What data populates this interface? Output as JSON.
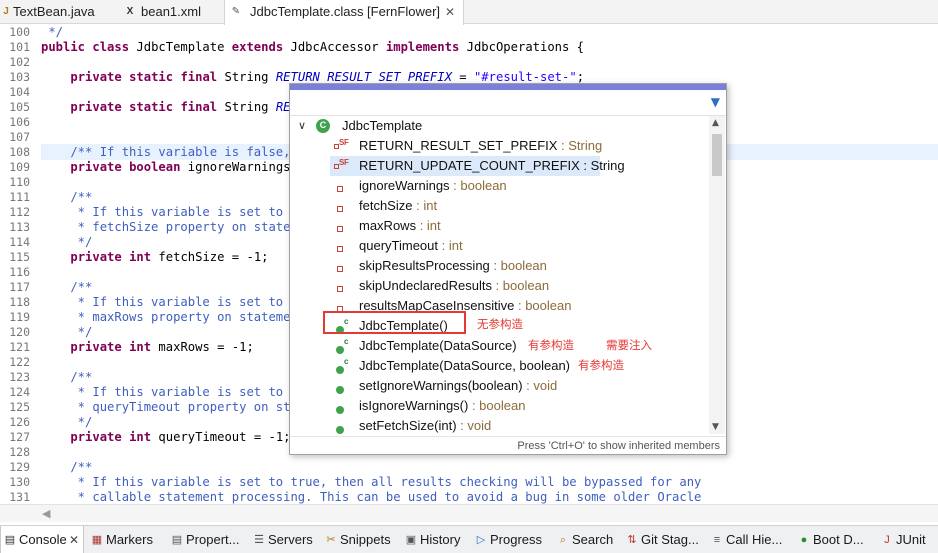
{
  "editor_tabs": [
    {
      "label": "TextBean.java"
    },
    {
      "label": "bean1.xml"
    },
    {
      "label": "JdbcTemplate.class [FernFlower]"
    }
  ],
  "code_lines": [
    {
      "n": "100",
      "text": " */"
    },
    {
      "n": "101",
      "text": "public class JdbcTemplate extends JdbcAccessor implements JdbcOperations {"
    },
    {
      "n": "102",
      "text": ""
    },
    {
      "n": "103",
      "text": "    private static final String RETURN_RESULT_SET_PREFIX = \"#result-set-\";"
    },
    {
      "n": "104",
      "text": ""
    },
    {
      "n": "105",
      "text": "    private static final String RETU"
    },
    {
      "n": "106",
      "text": ""
    },
    {
      "n": "107",
      "text": ""
    },
    {
      "n": "108",
      "text": "    /** If this variable is false, w"
    },
    {
      "n": "109",
      "text": "    private boolean ignoreWarnings ="
    },
    {
      "n": "110",
      "text": ""
    },
    {
      "n": "111",
      "text": "    /**"
    },
    {
      "n": "112",
      "text": "     * If this variable is set to a"
    },
    {
      "n": "113",
      "text": "     * fetchSize property on stateme"
    },
    {
      "n": "114",
      "text": "     */"
    },
    {
      "n": "115",
      "text": "    private int fetchSize = -1;"
    },
    {
      "n": "116",
      "text": ""
    },
    {
      "n": "117",
      "text": "    /**"
    },
    {
      "n": "118",
      "text": "     * If this variable is set to a"
    },
    {
      "n": "119",
      "text": "     * maxRows property on statement"
    },
    {
      "n": "120",
      "text": "     */"
    },
    {
      "n": "121",
      "text": "    private int maxRows = -1;"
    },
    {
      "n": "122",
      "text": ""
    },
    {
      "n": "123",
      "text": "    /**"
    },
    {
      "n": "124",
      "text": "     * If this variable is set to a"
    },
    {
      "n": "125",
      "text": "     * queryTimeout property on stat"
    },
    {
      "n": "126",
      "text": "     */"
    },
    {
      "n": "127",
      "text": "    private int queryTimeout = -1;"
    },
    {
      "n": "128",
      "text": ""
    },
    {
      "n": "129",
      "text": "    /**"
    },
    {
      "n": "130",
      "text": "     * If this variable is set to true, then all results checking will be bypassed for any"
    },
    {
      "n": "131",
      "text": "     * callable statement processing. This can be used to avoid a bug in some older Oracle"
    }
  ],
  "outline": {
    "root": "JdbcTemplate",
    "items": [
      {
        "name": "RETURN_RESULT_SET_PREFIX",
        "type": " : String",
        "kind": "static-field"
      },
      {
        "name": "RETURN_UPDATE_COUNT_PREFIX : String",
        "type": "",
        "kind": "static-field",
        "selected": true
      },
      {
        "name": "ignoreWarnings",
        "type": " : boolean",
        "kind": "field"
      },
      {
        "name": "fetchSize",
        "type": " : int",
        "kind": "field"
      },
      {
        "name": "maxRows",
        "type": " : int",
        "kind": "field"
      },
      {
        "name": "queryTimeout",
        "type": " : int",
        "kind": "field"
      },
      {
        "name": "skipResultsProcessing",
        "type": " : boolean",
        "kind": "field"
      },
      {
        "name": "skipUndeclaredResults",
        "type": " : boolean",
        "kind": "field"
      },
      {
        "name": "resultsMapCaseInsensitive",
        "type": " : boolean",
        "kind": "field"
      },
      {
        "name": "JdbcTemplate()",
        "type": "",
        "kind": "constructor"
      },
      {
        "name": "JdbcTemplate(DataSource)",
        "type": "",
        "kind": "constructor"
      },
      {
        "name": "JdbcTemplate(DataSource, boolean)",
        "type": "",
        "kind": "constructor"
      },
      {
        "name": "setIgnoreWarnings(boolean)",
        "type": " : void",
        "kind": "method"
      },
      {
        "name": "isIgnoreWarnings()",
        "type": " : boolean",
        "kind": "method"
      },
      {
        "name": "setFetchSize(int)",
        "type": " : void",
        "kind": "method"
      }
    ],
    "status": "Press 'Ctrl+O' to show inherited members"
  },
  "annotations": {
    "no_arg": "无参构造",
    "has_arg_1": "有参构造",
    "needs_inject": "需要注入",
    "has_arg_2": "有参构造"
  },
  "view_tabs": [
    {
      "label": "Console",
      "icon": "console-icon"
    },
    {
      "label": "Markers",
      "icon": "markers-icon"
    },
    {
      "label": "Propert...",
      "icon": "properties-icon"
    },
    {
      "label": "Servers",
      "icon": "servers-icon"
    },
    {
      "label": "Snippets",
      "icon": "snippets-icon"
    },
    {
      "label": "History",
      "icon": "history-icon"
    },
    {
      "label": "Progress",
      "icon": "progress-icon"
    },
    {
      "label": "Search",
      "icon": "search-icon"
    },
    {
      "label": "Git Stag...",
      "icon": "git-staging-icon"
    },
    {
      "label": "Call Hie...",
      "icon": "call-hierarchy-icon"
    },
    {
      "label": "Boot D...",
      "icon": "boot-dashboard-icon"
    },
    {
      "label": "JUnit",
      "icon": "junit-icon"
    }
  ],
  "colors": {
    "keyword": "#7f0055",
    "comment": "#3f5fbf",
    "string": "#2a00ff",
    "field": "#0000c0",
    "annotation_red": "#e53935",
    "popup_accent": "#7b7fd8"
  }
}
